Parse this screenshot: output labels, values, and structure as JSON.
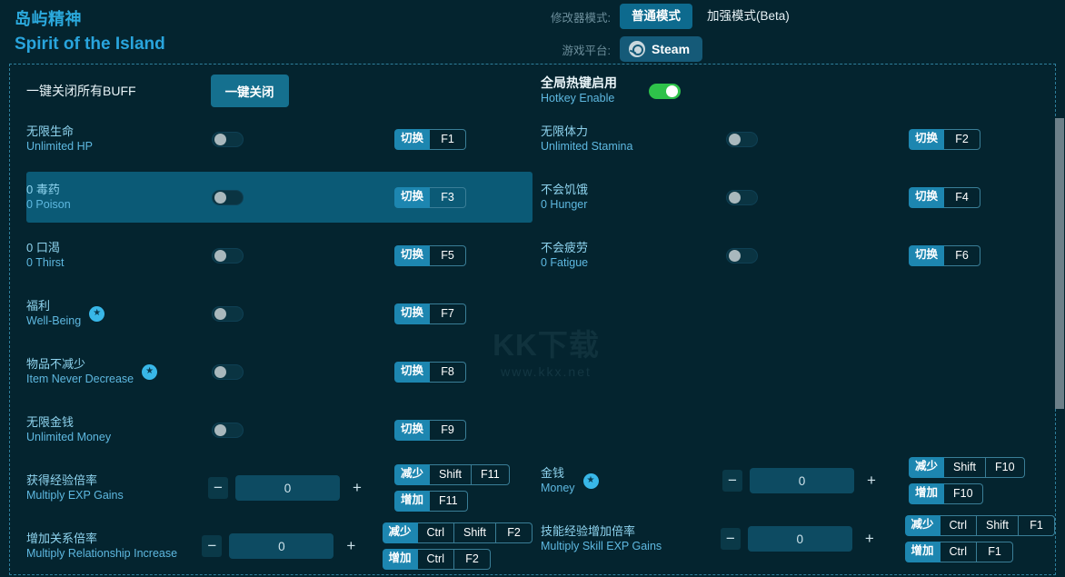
{
  "header": {
    "title_cn": "岛屿精神",
    "title_en": "Spirit of the Island",
    "mode_label": "修改器模式:",
    "mode_normal": "普通模式",
    "mode_enhanced": "加强模式(Beta)",
    "platform_label": "游戏平台:",
    "platform_value": "Steam",
    "platform_icon": "steam-icon"
  },
  "top_actions": {
    "close_all_label": "一键关闭所有BUFF",
    "close_all_button": "一键关闭",
    "hotkey_cn": "全局热键启用",
    "hotkey_en": "Hotkey Enable",
    "hotkey_state": "on"
  },
  "labels": {
    "toggle_tag": "切换",
    "decrease_tag": "减少",
    "increase_tag": "增加"
  },
  "watermark": {
    "big": "KK下载",
    "small": "www.kkx.net"
  },
  "colors": {
    "background": "#04242f",
    "accent": "#2ba9dd",
    "row_highlight": "#0b5a76",
    "toggle_on": "#2ec24a",
    "key_tag": "#1d86b0",
    "star": "#38b7e8"
  },
  "left_column": [
    {
      "cn": "无限生命",
      "en": "Unlimited HP",
      "star": false,
      "control": "toggle",
      "toggle": "off",
      "highlight": false,
      "keys": [
        {
          "tag": "切换",
          "caps": [
            "F1"
          ]
        }
      ]
    },
    {
      "cn": "0 毒药",
      "en": "0 Poison",
      "star": false,
      "control": "toggle",
      "toggle": "off",
      "highlight": true,
      "keys": [
        {
          "tag": "切换",
          "caps": [
            "F3"
          ]
        }
      ]
    },
    {
      "cn": "0 口渴",
      "en": "0 Thirst",
      "star": false,
      "control": "toggle",
      "toggle": "off",
      "highlight": false,
      "keys": [
        {
          "tag": "切换",
          "caps": [
            "F5"
          ]
        }
      ]
    },
    {
      "cn": "福利",
      "en": "Well-Being",
      "star": true,
      "control": "toggle",
      "toggle": "off",
      "highlight": false,
      "keys": [
        {
          "tag": "切换",
          "caps": [
            "F7"
          ]
        }
      ]
    },
    {
      "cn": "物品不减少",
      "en": "Item Never Decrease",
      "star": true,
      "control": "toggle",
      "toggle": "off",
      "highlight": false,
      "keys": [
        {
          "tag": "切换",
          "caps": [
            "F8"
          ]
        }
      ]
    },
    {
      "cn": "无限金钱",
      "en": "Unlimited Money",
      "star": false,
      "control": "toggle",
      "toggle": "off",
      "highlight": false,
      "keys": [
        {
          "tag": "切换",
          "caps": [
            "F9"
          ]
        }
      ]
    },
    {
      "cn": "获得经验倍率",
      "en": "Multiply EXP Gains",
      "star": false,
      "control": "stepper",
      "value": "0",
      "highlight": false,
      "keys": [
        {
          "tag": "减少",
          "caps": [
            "Shift",
            "F11"
          ]
        },
        {
          "tag": "增加",
          "caps": [
            "F11"
          ]
        }
      ]
    },
    {
      "cn": "增加关系倍率",
      "en": "Multiply Relationship Increase",
      "star": false,
      "control": "stepper",
      "value": "0",
      "highlight": false,
      "keys": [
        {
          "tag": "减少",
          "caps": [
            "Ctrl",
            "Shift",
            "F2"
          ]
        },
        {
          "tag": "增加",
          "caps": [
            "Ctrl",
            "F2"
          ]
        }
      ]
    }
  ],
  "right_column": [
    {
      "cn": "无限体力",
      "en": "Unlimited Stamina",
      "star": false,
      "control": "toggle",
      "toggle": "off",
      "highlight": false,
      "keys": [
        {
          "tag": "切换",
          "caps": [
            "F2"
          ]
        }
      ]
    },
    {
      "cn": "不会饥饿",
      "en": "0 Hunger",
      "star": false,
      "control": "toggle",
      "toggle": "off",
      "highlight": false,
      "keys": [
        {
          "tag": "切换",
          "caps": [
            "F4"
          ]
        }
      ]
    },
    {
      "cn": "不会疲劳",
      "en": "0 Fatigue",
      "star": false,
      "control": "toggle",
      "toggle": "off",
      "highlight": false,
      "keys": [
        {
          "tag": "切换",
          "caps": [
            "F6"
          ]
        }
      ]
    },
    {
      "cn": "金钱",
      "en": "Money",
      "star": true,
      "control": "stepper",
      "value": "0",
      "highlight": false,
      "offset": 4,
      "keys": [
        {
          "tag": "减少",
          "caps": [
            "Shift",
            "F10"
          ]
        },
        {
          "tag": "增加",
          "caps": [
            "F10"
          ]
        }
      ]
    },
    {
      "cn": "技能经验增加倍率",
      "en": "Multiply Skill EXP Gains",
      "star": false,
      "control": "stepper",
      "value": "0",
      "highlight": false,
      "offset": 5,
      "keys": [
        {
          "tag": "减少",
          "caps": [
            "Ctrl",
            "Shift",
            "F1"
          ]
        },
        {
          "tag": "增加",
          "caps": [
            "Ctrl",
            "F1"
          ]
        }
      ]
    }
  ]
}
